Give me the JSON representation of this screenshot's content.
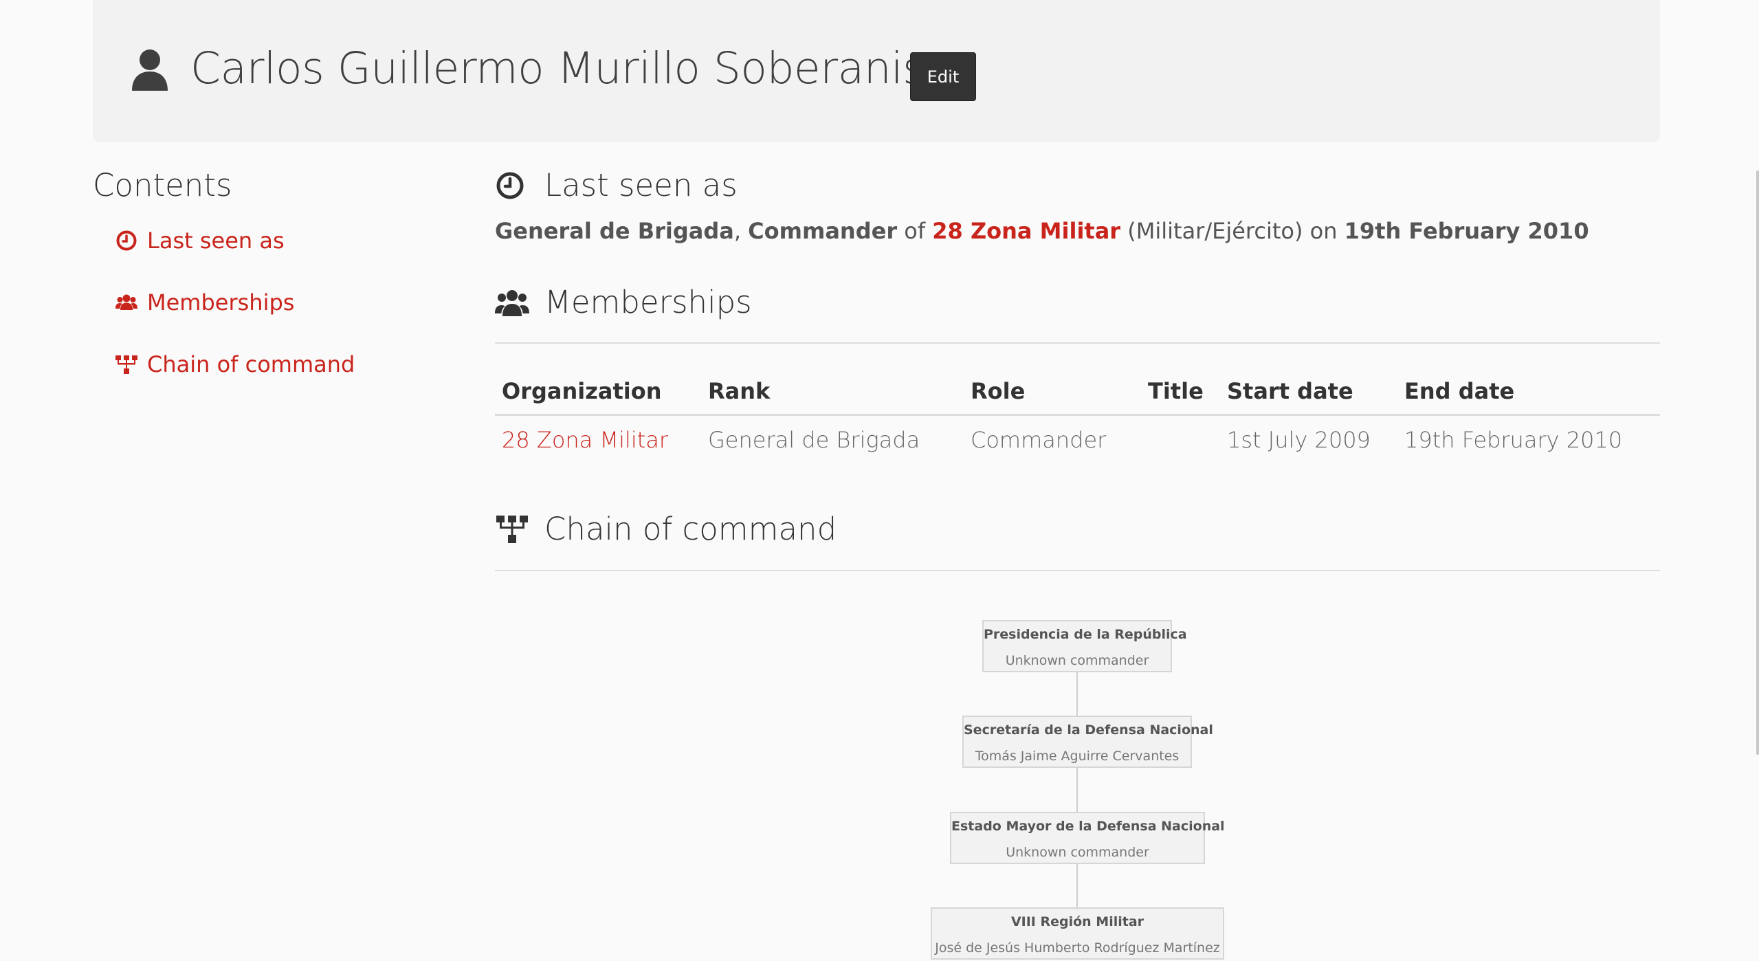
{
  "header": {
    "person_name": "Carlos Guillermo Murillo Soberanis",
    "edit_label": "Edit",
    "person_icon": "user-icon"
  },
  "contents": {
    "title": "Contents",
    "items": [
      {
        "label": "Last seen as",
        "icon": "clock-icon"
      },
      {
        "label": "Memberships",
        "icon": "users-icon"
      },
      {
        "label": "Chain of command",
        "icon": "sitemap-icon"
      }
    ]
  },
  "last_seen": {
    "heading": "Last seen as",
    "rank": "General de Brigada",
    "sep": ",",
    "role": "Commander",
    "of": "of",
    "org": "28 Zona Militar",
    "branch": "(Militar/Ejército)",
    "on": "on",
    "date": "19th February 2010"
  },
  "memberships": {
    "heading": "Memberships",
    "columns": [
      "Organization",
      "Rank",
      "Role",
      "Title",
      "Start date",
      "End date"
    ],
    "rows": [
      [
        "28 Zona Militar",
        "General de Brigada",
        "Commander",
        "",
        "1st July 2009",
        "19th February 2010"
      ]
    ]
  },
  "chain_of_command": {
    "heading": "Chain of command",
    "nodes": [
      {
        "name": "Presidencia de la República",
        "commander": "Unknown commander"
      },
      {
        "name": "Secretaría de la Defensa Nacional",
        "commander": "Tomás Jaime Aguirre Cervantes"
      },
      {
        "name": "Estado Mayor de la Defensa Nacional",
        "commander": "Unknown commander"
      },
      {
        "name": "VIII Región Militar",
        "commander": "José de Jesús Humberto Rodríguez Martínez"
      }
    ]
  },
  "colors": {
    "accent": "#c9241c",
    "heading": "#333333",
    "jumbotron_bg": "#f2f2f2",
    "button_bg": "#333333"
  }
}
